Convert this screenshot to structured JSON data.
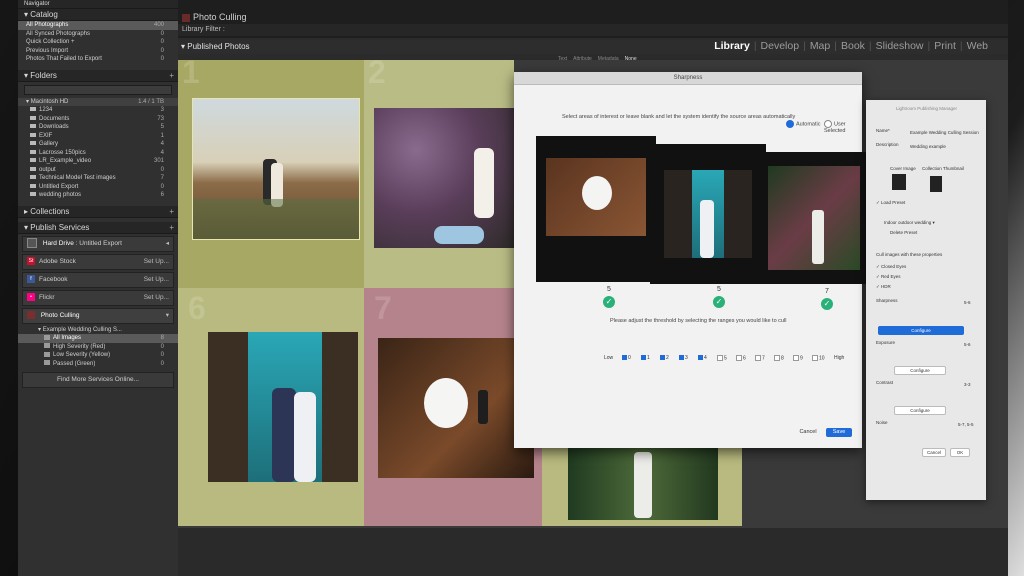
{
  "navigator_title": "Navigator",
  "catalog": {
    "title": "Catalog",
    "items": [
      {
        "label": "All Photographs",
        "count": "400"
      },
      {
        "label": "All Synced Photographs",
        "count": "0"
      },
      {
        "label": "Quick Collection +",
        "count": "0"
      },
      {
        "label": "Previous Import",
        "count": "0"
      },
      {
        "label": "Photos That Failed to Export",
        "count": "0"
      }
    ]
  },
  "folders": {
    "title": "Folders",
    "search_placeholder": "",
    "drive": {
      "label": "Macintosh HD",
      "info": "1.4 / 1 TB"
    },
    "items": [
      {
        "label": "1234",
        "count": "3"
      },
      {
        "label": "Documents",
        "count": "73"
      },
      {
        "label": "Downloads",
        "count": "5"
      },
      {
        "label": "EXIF",
        "count": "1"
      },
      {
        "label": "Gallery",
        "count": "4"
      },
      {
        "label": "Lacrosse 150pics",
        "count": "4"
      },
      {
        "label": "LR_Example_video",
        "count": "301"
      },
      {
        "label": "output",
        "count": "0"
      },
      {
        "label": "Technical Model Test images",
        "count": "7"
      },
      {
        "label": "Untitled Export",
        "count": "0"
      },
      {
        "label": "wedding photos",
        "count": "6"
      }
    ]
  },
  "collections": {
    "title": "Collections"
  },
  "publish": {
    "title": "Publish Services",
    "hard_drive": {
      "label": "Hard Drive",
      "sub": "Untitled Export"
    },
    "services": [
      {
        "label": "Adobe Stock",
        "action": "Set Up...",
        "color": "#c8102e",
        "icon": "St"
      },
      {
        "label": "Facebook",
        "action": "Set Up...",
        "color": "#3b5998",
        "icon": "f"
      },
      {
        "label": "Flickr",
        "action": "Set Up...",
        "color": "#ff0084",
        "icon": "•"
      }
    ],
    "photo_culling": {
      "label": "Photo Culling",
      "collection": "Example Wedding Culling S...",
      "items": [
        {
          "label": "All Images",
          "count": "8"
        },
        {
          "label": "High Severity (Red)",
          "count": "0"
        },
        {
          "label": "Low Severity (Yellow)",
          "count": "0"
        },
        {
          "label": "Passed (Green)",
          "count": "0"
        }
      ]
    },
    "find_more": "Find More Services Online..."
  },
  "top": {
    "brand": "Photo Culling",
    "library_filter": "Library Filter :",
    "published_photos": "Published Photos",
    "modules": [
      "Library",
      "Develop",
      "Map",
      "Book",
      "Slideshow",
      "Print",
      "Web"
    ],
    "active_module": "Library",
    "filter_tabs": [
      "Text",
      "Attribute",
      "Metadata",
      "None"
    ]
  },
  "grid": {
    "cells": [
      {
        "num": "1",
        "bg": "#a8a865"
      },
      {
        "num": "2",
        "bg": "#b9bc85"
      },
      {
        "num": "6",
        "bg": "#b8ba7f"
      },
      {
        "num": "7",
        "bg": "#b5838b"
      }
    ]
  },
  "dialog": {
    "title": "Sharpness",
    "instruction": "Select areas of interest or leave blank and let the system identify the source areas automatically",
    "radio_automatic": "Automatic",
    "radio_user": "User Selected",
    "scores": [
      "5",
      "5",
      "7"
    ],
    "threshold_note": "Please adjust the threshold by selecting the ranges you would like to cull",
    "scale_low": "Low",
    "scale_high": "High",
    "scale": [
      "0",
      "1",
      "2",
      "3",
      "4",
      "5",
      "6",
      "7",
      "8",
      "9",
      "10"
    ],
    "scale_checked": [
      true,
      true,
      true,
      true,
      true,
      false,
      false,
      false,
      false,
      false,
      false
    ],
    "cancel": "Cancel",
    "save": "Save"
  },
  "right_panel": {
    "header": "Lightroom Publishing Manager",
    "name_label": "Name*",
    "name_value": "Example Wedding Culling Session",
    "description_label": "Description",
    "description_value": "Wedding example",
    "cover_image": "Cover Image",
    "collection_thumbnail": "Collection Thumbnail",
    "load_preset": "Load Preset",
    "preset_value": "Indoor outdoor wedding",
    "delete_preset": "Delete Preset",
    "cull_title": "Cull images with these properties",
    "closed_eyes": "Closed Eyes",
    "red_eyes": "Red Eyes",
    "hdr": "HDR",
    "sharpness": "Sharpness",
    "sharpness_value": "5-6",
    "configure_active": "Configure",
    "exposure": "Exposure",
    "exposure_value": "5-6",
    "configure": "Configure",
    "contrast": "Contrast",
    "contrast_value": "3-3",
    "noise": "Noise",
    "noise_value": "5-7, 5-5",
    "cancel": "Cancel",
    "ok": "OK",
    "accent": "#1f6bd8"
  }
}
